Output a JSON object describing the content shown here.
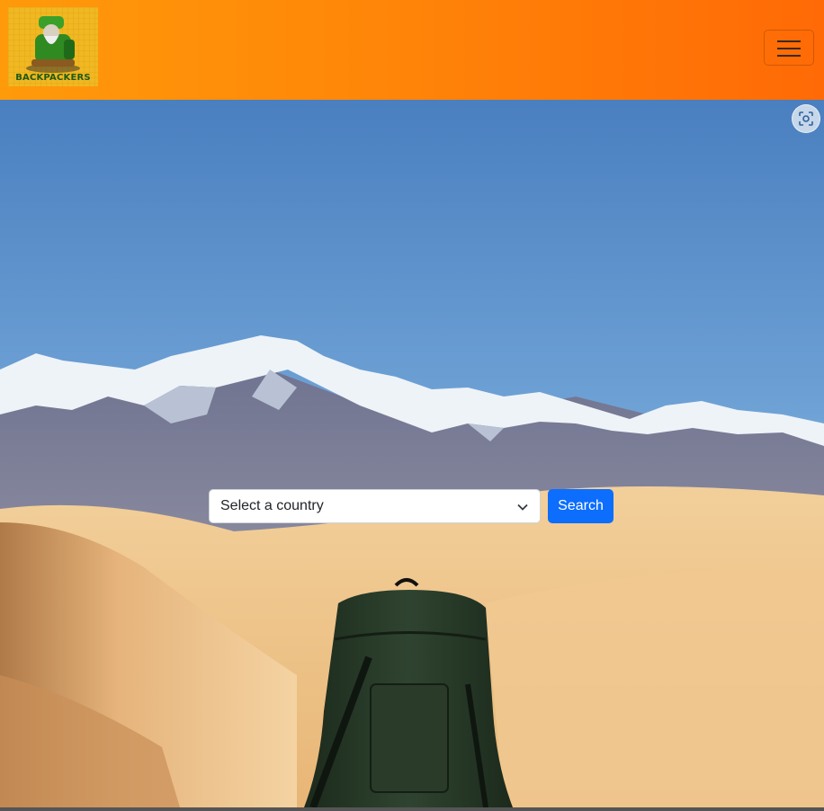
{
  "navbar": {
    "logo_text": "BACKPACKERS",
    "menu_icon": "hamburger-icon"
  },
  "hero": {
    "scene": "snowy mountains and desert dunes with backpack",
    "lens_icon": "visual-search-icon"
  },
  "search": {
    "select_value": "Select a country",
    "button_label": "Search"
  },
  "colors": {
    "navbar_start": "#ff9a0a",
    "navbar_end": "#ff6a06",
    "button": "#0d6efd"
  }
}
